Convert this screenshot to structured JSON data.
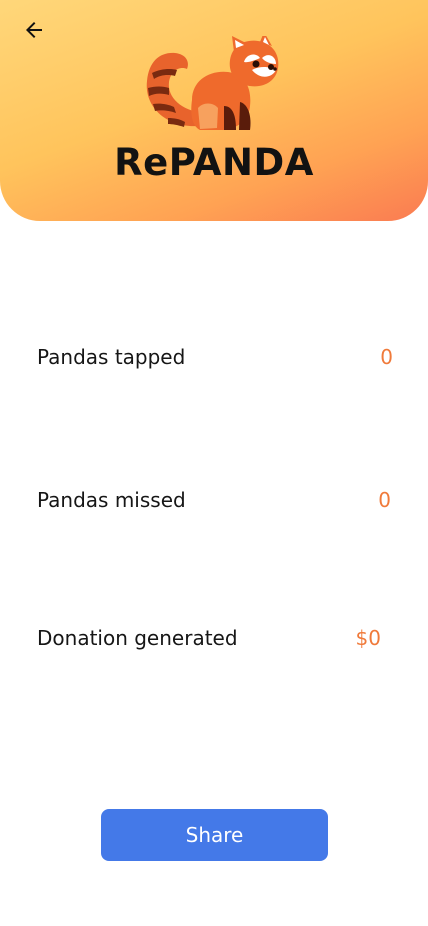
{
  "header": {
    "back_icon": "arrow-left-icon",
    "logo_icon": "red-panda-icon",
    "brand_name": "RePANDA",
    "gradient_colors": [
      "#FFD77A",
      "#FFC45C",
      "#FFA253",
      "#FA7B52"
    ]
  },
  "stats": {
    "tapped_label": "Pandas tapped",
    "tapped_value": "0",
    "missed_label": "Pandas missed",
    "missed_value": "0",
    "donation_label": "Donation generated",
    "donation_value": "$0",
    "value_color": "#F07A3A"
  },
  "actions": {
    "share_label": "Share",
    "share_color": "#4479E8"
  }
}
